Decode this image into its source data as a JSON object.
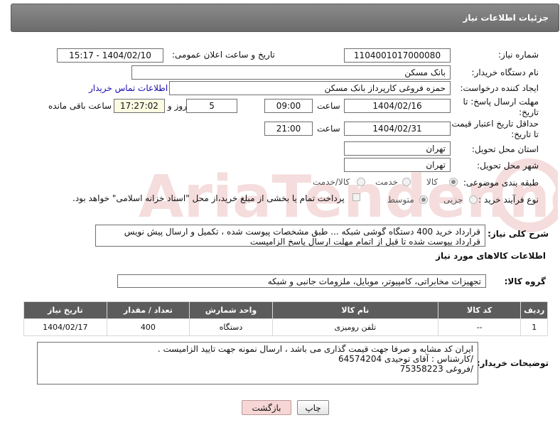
{
  "panel": {
    "title": "جزئیات اطلاعات نیاز"
  },
  "fields": {
    "need_number_label": "شماره نیاز:",
    "need_number": "1104001017000080",
    "announce_label": "تاریخ و ساعت اعلان عمومی:",
    "announce_value": "1404/02/10 - 15:17",
    "buyer_org_label": "نام دستگاه خریدار:",
    "buyer_org": "بانک مسکن",
    "creator_label": "ایجاد کننده درخواست:",
    "creator": "حمزه فروغی کارپرداز بانک مسکن",
    "contact_link": "اطلاعات تماس خریدار",
    "deadline_label": "مهلت ارسال پاسخ: تا تاریخ:",
    "deadline_date": "1404/02/16",
    "time_label": "ساعت",
    "deadline_time": "09:00",
    "days_value": "5",
    "days_label": "روز و",
    "remaining_time": "17:27:02",
    "remaining_label": "ساعت باقی مانده",
    "price_validity_label": "حداقل تاریخ اعتبار قیمت: تا تاریخ:",
    "price_validity_date": "1404/02/31",
    "price_validity_time": "21:00",
    "province_label": "استان محل تحویل:",
    "province": "تهران",
    "city_label": "شهر محل تحویل:",
    "city": "تهران",
    "category_label": "طبقه بندی موضوعی:",
    "category_options": [
      "کالا",
      "خدمت",
      "کالا/خدمت"
    ],
    "process_label": "نوع فرآیند خرید :",
    "process_options": [
      "جزیی",
      "متوسط"
    ],
    "payment_note": "پرداخت تمام یا بخشی از مبلغ خرید،از محل \"اسناد خزانه اسلامی\" خواهد بود."
  },
  "description": {
    "label": "شرح کلی نیاز:",
    "text": "قرارداد خرید 400 دستگاه گوشی شبکه ...   طبق مشخصات پیوست شده ، تکمیل و ارسال پیش نویس قرارداد پیوست شده تا قبل از اتمام مهلت ارسال پاسخ الزامیست"
  },
  "goods": {
    "section_title": "اطلاعات کالاهای مورد نیاز",
    "group_label": "گروه کالا:",
    "group_value": "تجهیزات مخابراتی، کامپیوتر، موبایل، ملزومات جانبی و شبکه",
    "columns": [
      "ردیف",
      "کد کالا",
      "نام کالا",
      "واحد شمارش",
      "تعداد / مقدار",
      "تاریخ نیاز"
    ],
    "rows": [
      [
        "1",
        "--",
        "تلفن رومیزی",
        "دستگاه",
        "400",
        "1404/02/17"
      ]
    ]
  },
  "buyer_notes": {
    "label": "توضیحات خریدار:",
    "lines": [
      "ایران کد مشابه و صرفا جهت قیمت گذاری می باشد ، ارسال نمونه جهت تایید الزامیست .",
      "/کارشناس : آقای توحیدی 64574204",
      "/فروغی 75358223"
    ]
  },
  "buttons": {
    "print": "چاپ",
    "back": "بازگشت"
  },
  "watermark": {
    "text": "AriaTender.neT"
  }
}
